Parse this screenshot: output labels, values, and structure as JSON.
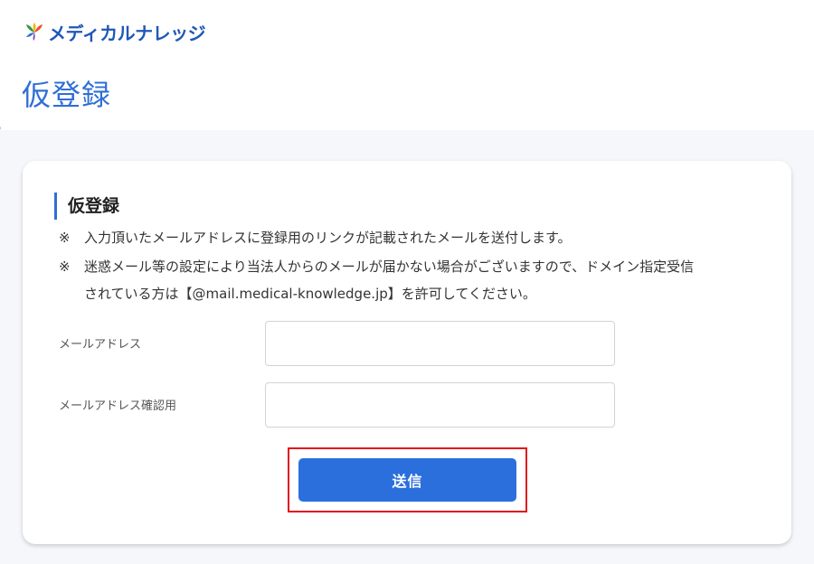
{
  "header": {
    "logo_text": "メディカルナレッジ",
    "logo_icon": "leaf-burst-logo-icon"
  },
  "page": {
    "title": "仮登録"
  },
  "form": {
    "section_title": "仮登録",
    "note_mark": "※",
    "notes": [
      "入力頂いたメールアドレスに登録用のリンクが記載されたメールを送付します。",
      "迷惑メール等の設定により当法人からのメールが届かない場合がございますので、ドメイン指定受信",
      "されている方は【@mail.medical-knowledge.jp】を許可してください。"
    ],
    "fields": {
      "email_label": "メールアドレス",
      "email_value": "",
      "email_confirm_label": "メールアドレス確認用",
      "email_confirm_value": ""
    },
    "submit_label": "送信"
  },
  "colors": {
    "accent": "#2b6fdc",
    "title_blue": "#2f6fd6",
    "highlight_red": "#e0161c",
    "background_gray": "#f6f7fb"
  }
}
